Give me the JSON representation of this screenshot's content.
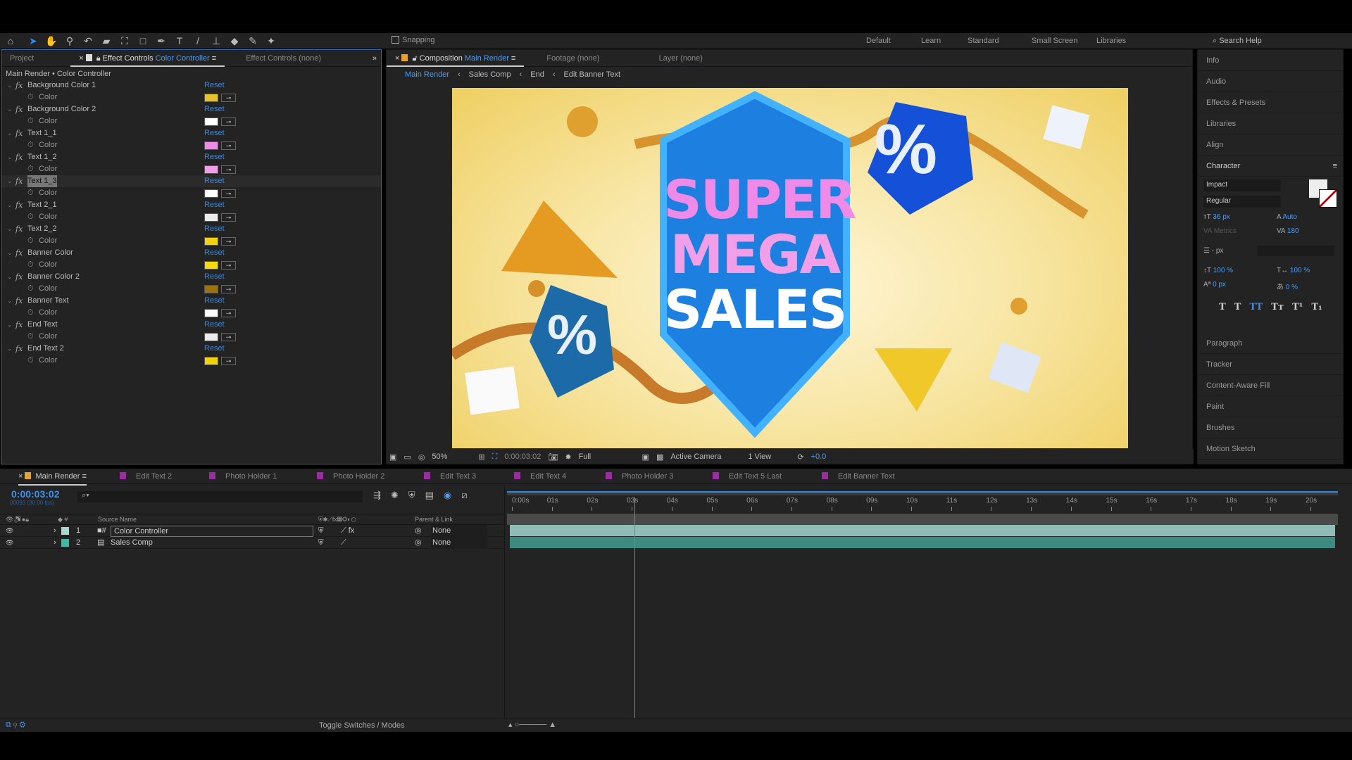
{
  "toolbar": {
    "snapping": "Snapping",
    "tools": [
      "home-icon",
      "selection-icon",
      "hand-icon",
      "zoom-icon",
      "rotate-icon",
      "camera-icon",
      "pan-behind-icon",
      "rectangle-icon",
      "pen-icon",
      "type-icon",
      "brush-icon",
      "clone-stamp-icon",
      "eraser-icon",
      "roto-brush-icon",
      "puppet-pin-icon"
    ],
    "workspaces": [
      "Default",
      "Learn",
      "Standard",
      "Small Screen",
      "Libraries"
    ],
    "search": "Search Help"
  },
  "effect_panel": {
    "tabs": {
      "project": "Project",
      "effect_controls": "Effect Controls",
      "effect_target": "Color Controller",
      "effect_none": "Effect Controls (none)"
    },
    "breadcrumb": "Main Render • Color Controller",
    "reset": "Reset",
    "property": "Color",
    "effects": [
      {
        "name": "Background Color 1",
        "color": "#e8c22a"
      },
      {
        "name": "Background Color 2",
        "color": "#ffffff"
      },
      {
        "name": "Text 1_1",
        "color": "#f08ae8"
      },
      {
        "name": "Text 1_2",
        "color": "#f39ee8"
      },
      {
        "name": "Text 1_3",
        "color": "#ffffff",
        "selected": true
      },
      {
        "name": "Text 2_1",
        "color": "#ececec"
      },
      {
        "name": "Text 2_2",
        "color": "#f2d20c"
      },
      {
        "name": "Banner Color",
        "color": "#f5d810"
      },
      {
        "name": "Banner Color 2",
        "color": "#a0720e"
      },
      {
        "name": "Banner Text",
        "color": "#fcfcfa"
      },
      {
        "name": "End Text",
        "color": "#ececec"
      },
      {
        "name": "End Text 2",
        "color": "#f2d20c"
      }
    ]
  },
  "composition": {
    "tab": "Composition",
    "comp_name": "Main Render",
    "footage": "Footage (none)",
    "layer": "Layer (none)",
    "breadcrumbs": [
      "Main Render",
      "Sales Comp",
      "End",
      "Edit Banner Text"
    ],
    "artwork": {
      "line1": "SUPER",
      "line2": "MEGA",
      "line3": "SALES",
      "badge": "%"
    },
    "viewer_bar": {
      "zoom": "50%",
      "timecode": "0:00:03:02",
      "resolution": "Full",
      "camera": "Active Camera",
      "views": "1 View",
      "exposure": "+0.0"
    }
  },
  "right_panels": {
    "top": [
      "Info",
      "Audio",
      "Effects & Presets",
      "Libraries",
      "Align"
    ],
    "character": "Character",
    "font": "Impact",
    "style": "Regular",
    "size": "36 px",
    "leading": "Auto",
    "kerning": "Metrics",
    "tracking": "180",
    "stroke": "- px",
    "vscale": "100 %",
    "hscale": "100 %",
    "baseline": "0 px",
    "tsume": "0 %",
    "styles": [
      "T",
      "T",
      "TT",
      "Tт",
      "T¹",
      "T₁"
    ],
    "bottom": [
      "Paragraph",
      "Tracker",
      "Content-Aware Fill",
      "Paint",
      "Brushes",
      "Motion Sketch"
    ]
  },
  "timeline": {
    "tabs": [
      "Main Render",
      "Edit Text 2",
      "Photo Holder 1",
      "Photo Holder 2",
      "Edit Text 3",
      "Edit Text 4",
      "Photo Holder 3",
      "Edit Text 5 Last",
      "Edit Banner Text"
    ],
    "timecode": "0:00:03:02",
    "frame": "00093 (30.00 fps)",
    "source_name": "Source Name",
    "parent_link": "Parent & Link",
    "ruler": [
      "0:00s",
      "01s",
      "02s",
      "03s",
      "04s",
      "05s",
      "06s",
      "07s",
      "08s",
      "09s",
      "10s",
      "11s",
      "12s",
      "13s",
      "14s",
      "15s",
      "16s",
      "17s",
      "18s",
      "19s",
      "20s"
    ],
    "playhead_seconds": 3.07,
    "layers": [
      {
        "num": "1",
        "name": "Color Controller",
        "label": "#a6d8cf",
        "parent": "None",
        "selected": true
      },
      {
        "num": "2",
        "name": "Sales Comp",
        "label": "#3fb8a4",
        "parent": "None"
      }
    ],
    "toggle": "Toggle Switches / Modes"
  }
}
